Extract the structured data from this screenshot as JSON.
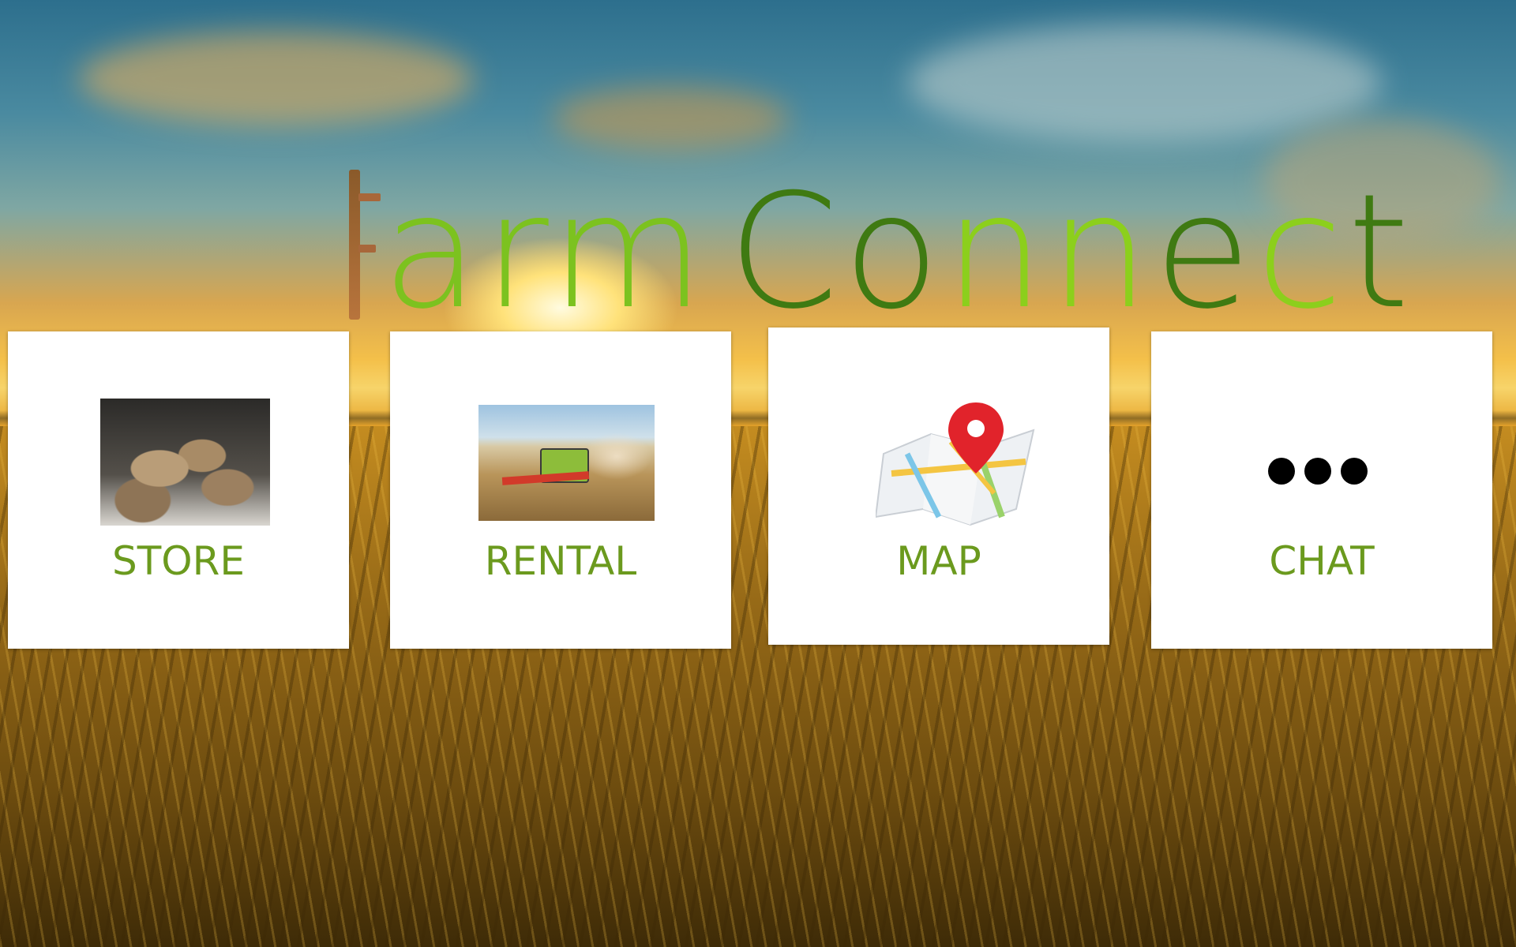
{
  "app": {
    "logo_parts": [
      "arm",
      "Co",
      "nn",
      "e",
      "c",
      "t"
    ]
  },
  "tiles": [
    {
      "label": "STORE",
      "icon": "bread-basket-photo"
    },
    {
      "label": "RENTAL",
      "icon": "combine-harvester-photo"
    },
    {
      "label": "MAP",
      "icon": "map-pin-icon"
    },
    {
      "label": "CHAT",
      "icon": "more-dots-icon"
    }
  ],
  "colors": {
    "label_green": "#6b9a1e",
    "logo_light_green": "#7cc21f",
    "logo_dark_green": "#3f7a12",
    "logo_brown": "#a8673a"
  }
}
